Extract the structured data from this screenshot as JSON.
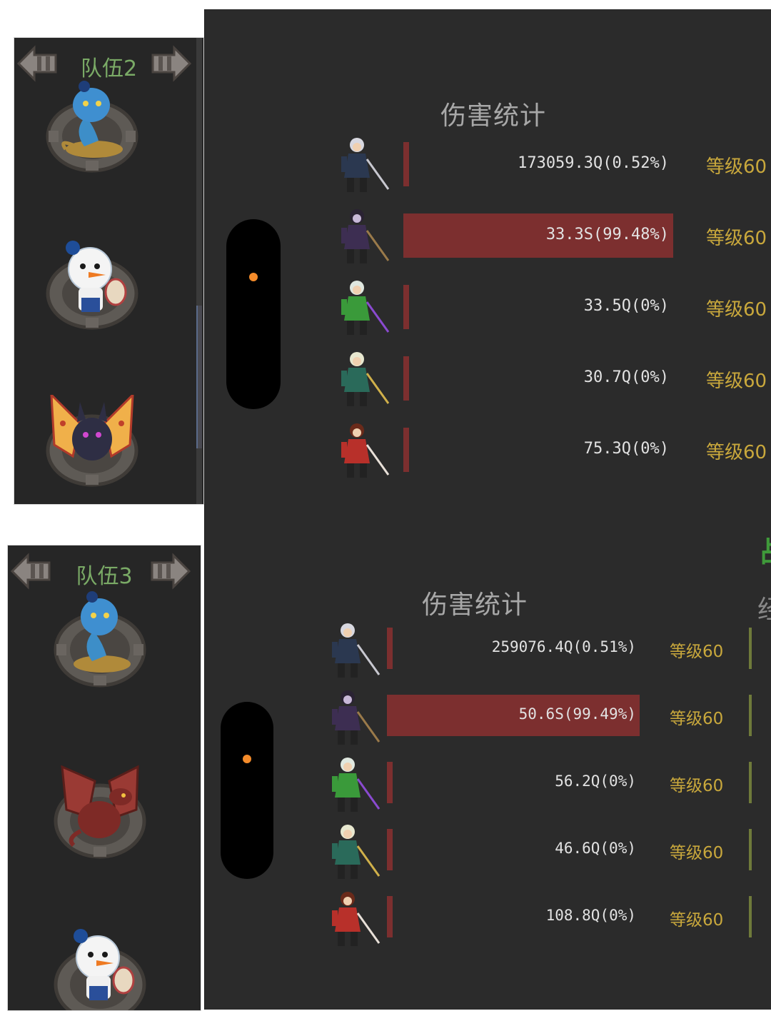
{
  "teams": [
    {
      "title": "队伍2",
      "creatures": [
        "genie-lamp",
        "snowman-chef",
        "pizza-bat"
      ]
    },
    {
      "title": "队伍3",
      "creatures": [
        "genie-lamp",
        "red-dragon",
        "snowman-chef"
      ]
    }
  ],
  "stats": [
    {
      "title": "伤害统计",
      "rows": [
        {
          "hero": "silver-swordsman",
          "damage": "173059.3Q(0.52%)",
          "share": 0.0052,
          "level": "等级60"
        },
        {
          "hero": "dark-mage",
          "damage": "33.3S(99.48%)",
          "share": 0.9948,
          "level": "等级60"
        },
        {
          "hero": "green-druid",
          "damage": "33.5Q(0%)",
          "share": 0,
          "level": "等级60"
        },
        {
          "hero": "elf-archer",
          "damage": "30.7Q(0%)",
          "share": 0,
          "level": "等级60"
        },
        {
          "hero": "red-monk",
          "damage": "75.3Q(0%)",
          "share": 0,
          "level": "等级60"
        }
      ]
    },
    {
      "title": "伤害统计",
      "rows": [
        {
          "hero": "silver-swordsman",
          "damage": "259076.4Q(0.51%)",
          "share": 0.0051,
          "level": "等级60"
        },
        {
          "hero": "dark-mage",
          "damage": "50.6S(99.49%)",
          "share": 0.9949,
          "level": "等级60"
        },
        {
          "hero": "green-druid",
          "damage": "56.2Q(0%)",
          "share": 0,
          "level": "等级60"
        },
        {
          "hero": "elf-archer",
          "damage": "46.6Q(0%)",
          "share": 0,
          "level": "等级60"
        },
        {
          "hero": "red-monk",
          "damage": "108.8Q(0%)",
          "share": 0,
          "level": "等级60"
        }
      ]
    }
  ],
  "clipped": {
    "green_heading_fragment": "战",
    "gray_heading_fragment": "经"
  },
  "colors": {
    "panel_bg": "#2b2b2b",
    "bar": "#7c2f2f",
    "level": "#c9a83c",
    "team_title": "#7aaa66",
    "dot": "#f48b2a"
  }
}
